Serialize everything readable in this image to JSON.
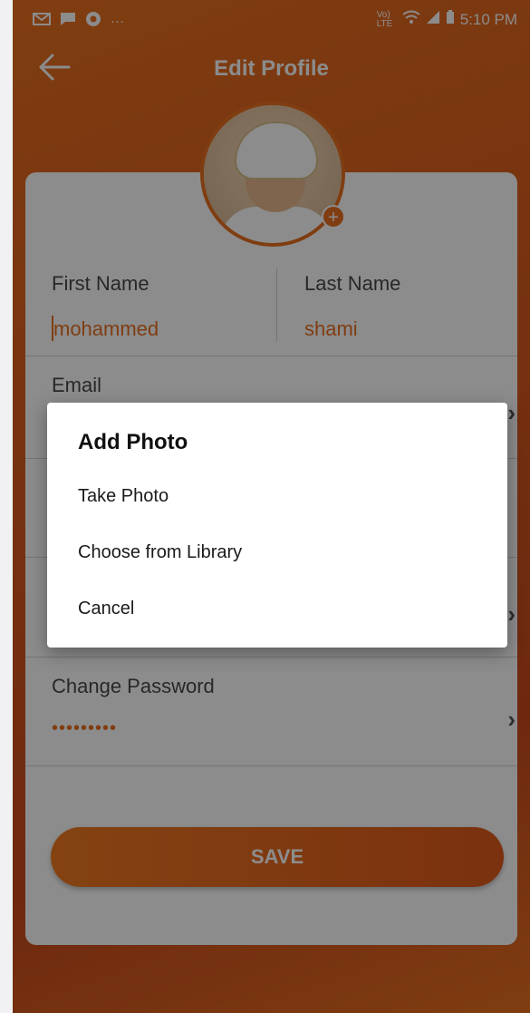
{
  "status_bar": {
    "left_icons": [
      "gmail-icon",
      "message-icon",
      "chrome-icon",
      "more-dots-icon"
    ],
    "network": "Vo) LTE",
    "time": "5:10 PM"
  },
  "appbar": {
    "title": "Edit Profile"
  },
  "form": {
    "first_name_label": "First Name",
    "first_name_value": "mohammed",
    "last_name_label": "Last Name",
    "last_name_value": "shami",
    "email_label": "Email",
    "change_password_label": "Change Password",
    "password_value": "•••••••••"
  },
  "save_button": {
    "label": "SAVE"
  },
  "dialog": {
    "title": "Add Photo",
    "options": [
      "Take Photo",
      "Choose from Library",
      "Cancel"
    ]
  },
  "colors": {
    "accent": "#e8701f",
    "header_gradient_end": "#c84a1e"
  }
}
